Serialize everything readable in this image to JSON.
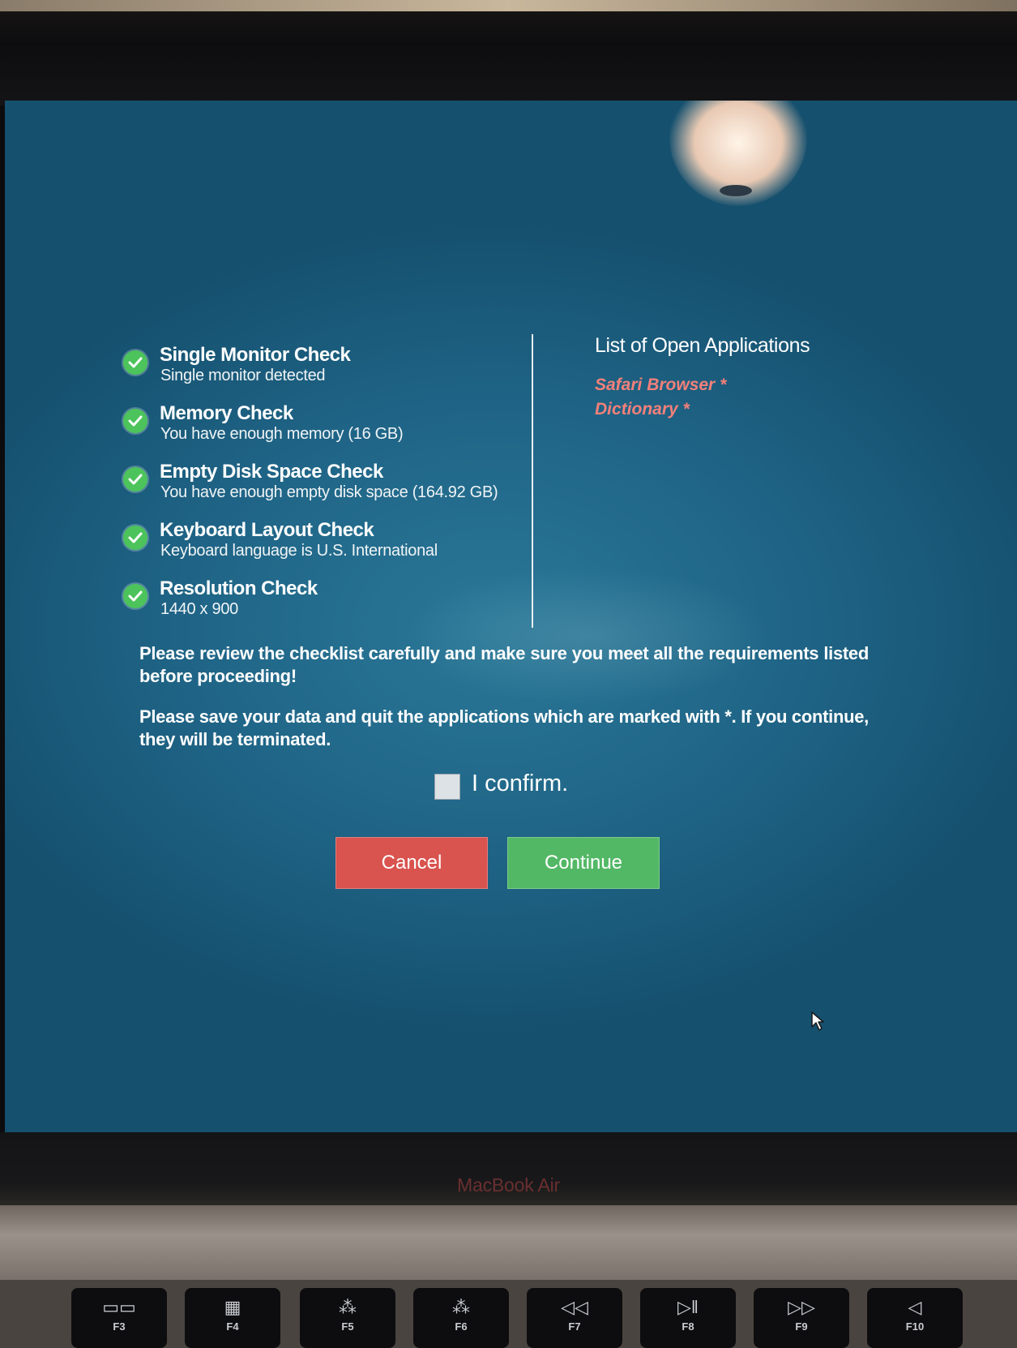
{
  "checks": [
    {
      "title": "Single Monitor Check",
      "detail": "Single monitor detected"
    },
    {
      "title": "Memory Check",
      "detail": "You have enough memory (16 GB)"
    },
    {
      "title": "Empty Disk Space Check",
      "detail": "You have enough empty disk space (164.92 GB)"
    },
    {
      "title": "Keyboard Layout Check",
      "detail": "Keyboard language is U.S. International"
    },
    {
      "title": "Resolution Check",
      "detail": "1440 x 900"
    }
  ],
  "open_apps": {
    "title": "List of Open Applications",
    "items": [
      "Safari Browser *",
      "Dictionary *"
    ]
  },
  "notices": {
    "review": "Please review the checklist carefully and make sure you meet all the requirements listed before proceeding!",
    "quit": "Please save your data and quit the applications which are marked with *. If you continue, they will be terminated."
  },
  "confirm": {
    "label": "I confirm.",
    "checked": false
  },
  "buttons": {
    "cancel": "Cancel",
    "continue": "Continue"
  },
  "device": {
    "brand": "MacBook Air"
  },
  "keys": [
    {
      "label": "F3",
      "icon": "mission-control-icon",
      "glyph": "▭▭"
    },
    {
      "label": "F4",
      "icon": "launchpad-icon",
      "glyph": "▦"
    },
    {
      "label": "F5",
      "icon": "keyboard-backlight-down-icon",
      "glyph": "⁂"
    },
    {
      "label": "F6",
      "icon": "keyboard-backlight-up-icon",
      "glyph": "⁂"
    },
    {
      "label": "F7",
      "icon": "rewind-icon",
      "glyph": "◁◁"
    },
    {
      "label": "F8",
      "icon": "play-pause-icon",
      "glyph": "▷‖"
    },
    {
      "label": "F9",
      "icon": "fast-forward-icon",
      "glyph": "▷▷"
    },
    {
      "label": "F10",
      "icon": "mute-icon",
      "glyph": "◁"
    }
  ],
  "colors": {
    "screen_bg": "#1f6486",
    "check_green": "#4cc35b",
    "app_red": "#f3807a",
    "cancel": "#d9534f",
    "continue": "#53b866"
  }
}
